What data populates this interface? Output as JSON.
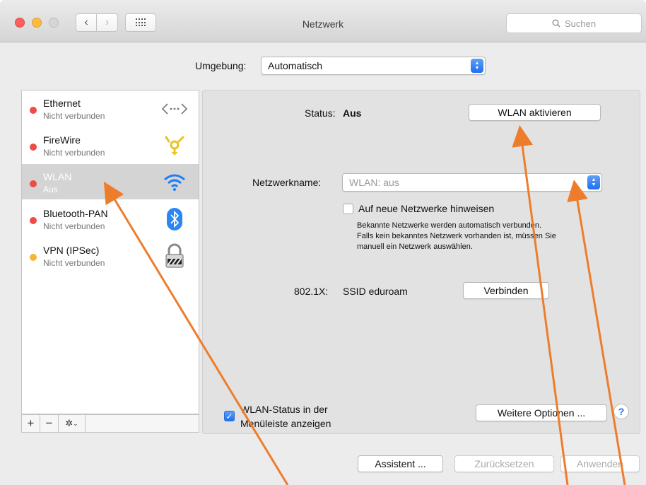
{
  "window": {
    "title": "Netzwerk",
    "search_placeholder": "Suchen"
  },
  "location": {
    "label": "Umgebung:",
    "value": "Automatisch"
  },
  "sidebar": {
    "items": [
      {
        "name": "Ethernet",
        "status": "Nicht verbunden",
        "dot": "red",
        "icon": "ethernet-icon",
        "selected": false
      },
      {
        "name": "FireWire",
        "status": "Nicht verbunden",
        "dot": "red",
        "icon": "firewire-icon",
        "selected": false
      },
      {
        "name": "WLAN",
        "status": "Aus",
        "dot": "red",
        "icon": "wifi-icon",
        "selected": true
      },
      {
        "name": "Bluetooth-PAN",
        "status": "Nicht verbunden",
        "dot": "red",
        "icon": "bluetooth-icon",
        "selected": false
      },
      {
        "name": "VPN (IPSec)",
        "status": "Nicht verbunden",
        "dot": "orange",
        "icon": "lock-icon",
        "selected": false
      }
    ],
    "add_label": "+",
    "remove_label": "−"
  },
  "panel": {
    "status_label": "Status:",
    "status_value": "Aus",
    "wifi_button": "WLAN aktivieren",
    "network_name_label": "Netzwerkname:",
    "network_name_value": "WLAN: aus",
    "ask_join_label": "Auf neue Netzwerke hinweisen",
    "ask_join_checked": false,
    "hint_lines": [
      "Bekannte Netzwerke werden automatisch verbunden.",
      "Falls kein bekanntes Netzwerk vorhanden ist, müssen Sie",
      "manuell ein Netzwerk auswählen."
    ],
    "dot1x_label": "802.1X:",
    "dot1x_value": "SSID eduroam",
    "connect_button": "Verbinden",
    "menubar_label_line1": "WLAN-Status in der",
    "menubar_label_line2": "Menüleiste anzeigen",
    "menubar_checked": true,
    "advanced_button": "Weitere Optionen ...",
    "help_label": "?"
  },
  "footer": {
    "assist_button": "Assistent ...",
    "revert_button": "Zurücksetzen",
    "apply_button": "Anwenden"
  },
  "colors": {
    "accent": "#1f6ff0",
    "status_red": "#ee4a46",
    "status_orange": "#f7b436",
    "arrow": "#ee7d2b"
  }
}
